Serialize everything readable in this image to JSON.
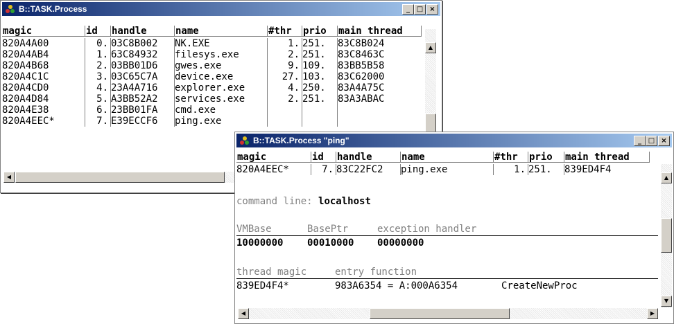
{
  "window1": {
    "title": "B::TASK.Process",
    "buttons": {
      "minimize": "_",
      "maximize": "□",
      "close": "×"
    },
    "columns": [
      "magic",
      "id",
      "handle",
      "name",
      "#thr",
      "prio",
      "main thread"
    ],
    "rows": [
      [
        "820A4A00",
        "0.",
        "03C8B002",
        "NK.EXE",
        "1.",
        "251.",
        "83C8B024"
      ],
      [
        "820A4AB4",
        "1.",
        "63C84932",
        "filesys.exe",
        "2.",
        "251.",
        "83C8463C"
      ],
      [
        "820A4B68",
        "2.",
        "03BB01D6",
        "gwes.exe",
        "9.",
        "109.",
        "83BB5B58"
      ],
      [
        "820A4C1C",
        "3.",
        "03C65C7A",
        "device.exe",
        "27.",
        "103.",
        "83C62000"
      ],
      [
        "820A4CD0",
        "4.",
        "23A4A716",
        "explorer.exe",
        "4.",
        "250.",
        "83A4A75C"
      ],
      [
        "820A4D84",
        "5.",
        "A3BB52A2",
        "services.exe",
        "2.",
        "251.",
        "83A3ABAC"
      ],
      [
        "820A4E38",
        "6.",
        "23BB01FA",
        "cmd.exe",
        "",
        "",
        ""
      ],
      [
        "820A4EEC*",
        "7.",
        "E39ECCF6",
        "ping.exe",
        "",
        "",
        ""
      ]
    ]
  },
  "window2": {
    "title": "B::TASK.Process \"ping\"",
    "buttons": {
      "minimize": "_",
      "maximize": "□",
      "close": "×"
    },
    "columns": [
      "magic",
      "id",
      "handle",
      "name",
      "#thr",
      "prio",
      "main thread"
    ],
    "row": [
      "820A4EEC*",
      "7.",
      "83C22FC2",
      "ping.exe",
      "1.",
      "251.",
      "839ED4F4"
    ],
    "command_line_label": "command line:",
    "command_line_value": "localhost",
    "mem_headers": {
      "vmbase": "VMBase",
      "baseptr": "BasePtr",
      "exception": "exception handler"
    },
    "mem_values": {
      "vmbase": "10000000",
      "baseptr": "00010000",
      "exception": "00000000"
    },
    "thread_headers": {
      "magic": "thread magic",
      "entry": "entry function"
    },
    "thread_row": {
      "magic": "839ED4F4*",
      "entry": "983A6354 = A:000A6354",
      "func": "CreateNewProc"
    }
  },
  "icons": {
    "app": "trace32-logo-icon",
    "up": "arrow-up-icon",
    "down": "arrow-down-icon",
    "left": "arrow-left-icon",
    "right": "arrow-right-icon"
  }
}
